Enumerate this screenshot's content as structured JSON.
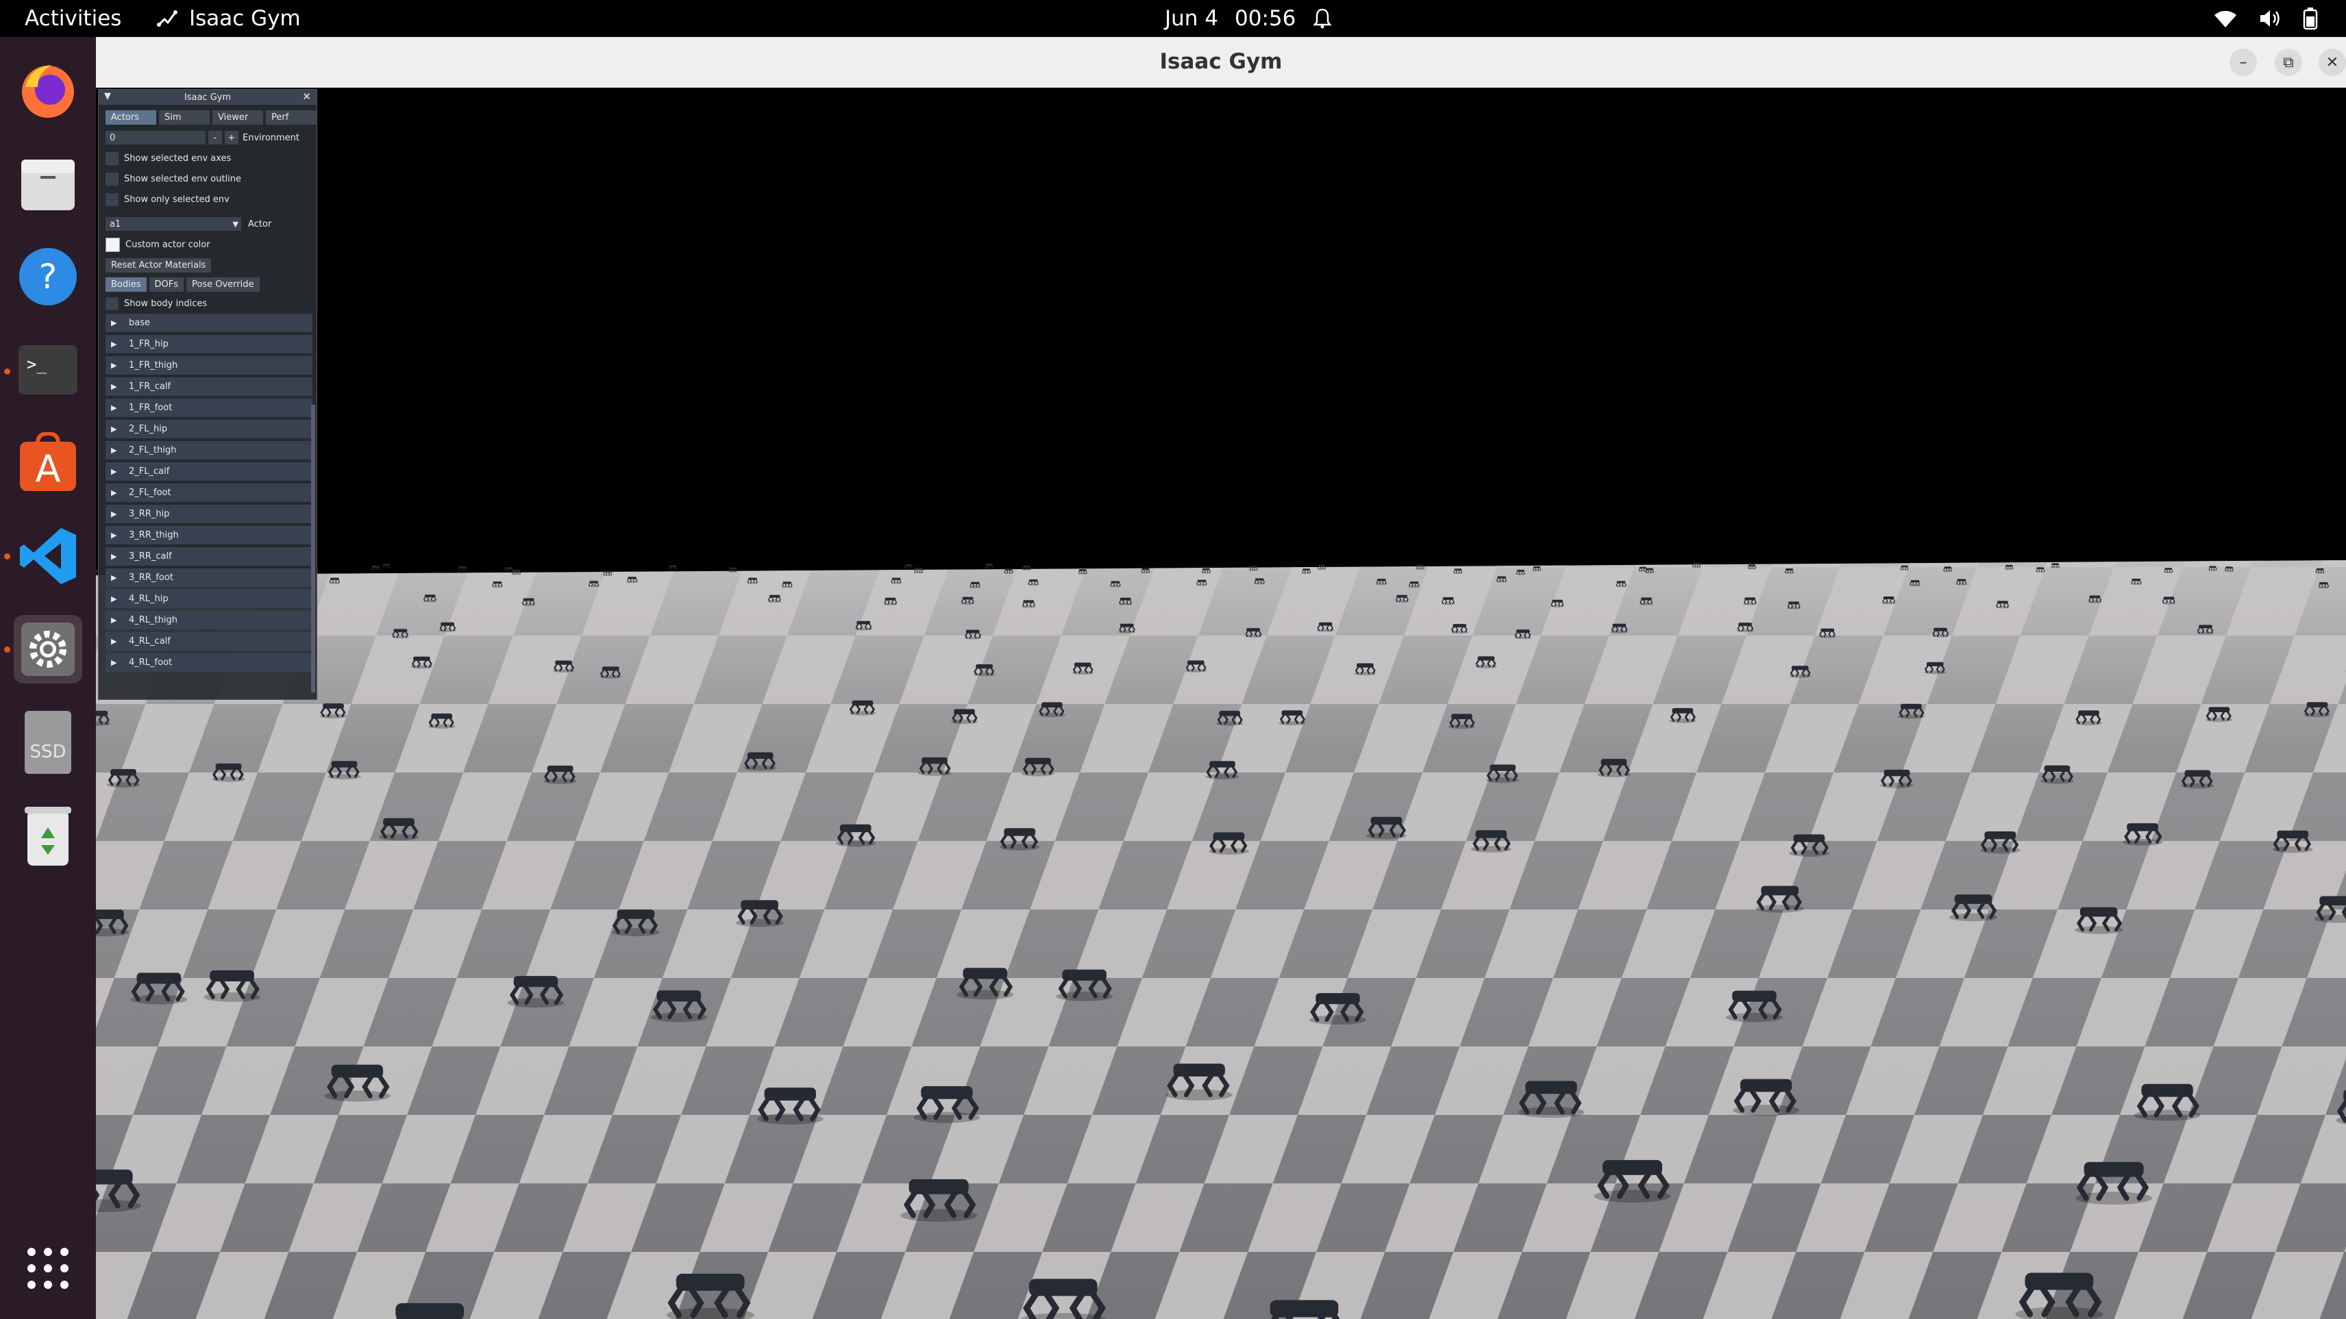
{
  "topbar": {
    "activities": "Activities",
    "app_name": "Isaac Gym",
    "date": "Jun 4",
    "time": "00:56"
  },
  "dock": {
    "icons": [
      "firefox-icon",
      "files-icon",
      "help-icon",
      "terminal-icon",
      "app-center-icon",
      "vscode-icon",
      "settings-icon",
      "ssd-drive-icon",
      "trash-icon",
      "show-apps-icon"
    ],
    "ssd_label": "SSD"
  },
  "window": {
    "title": "Isaac Gym"
  },
  "panel": {
    "title": "Isaac Gym",
    "tabs": [
      "Actors",
      "Sim",
      "Viewer",
      "Perf"
    ],
    "active_tab": "Actors",
    "env_value": "0",
    "env_minus": "-",
    "env_plus": "+",
    "env_label": "Environment",
    "options": [
      "Show selected env axes",
      "Show selected env outline",
      "Show only selected env"
    ],
    "actor_value": "a1",
    "actor_label": "Actor",
    "custom_color_label": "Custom actor color",
    "reset_button": "Reset Actor Materials",
    "subtabs": [
      "Bodies",
      "DOFs",
      "Pose Override"
    ],
    "active_subtab": "Bodies",
    "show_indices_label": "Show body indices",
    "bodies": [
      "base",
      "1_FR_hip",
      "1_FR_thigh",
      "1_FR_calf",
      "1_FR_foot",
      "2_FL_hip",
      "2_FL_thigh",
      "2_FL_calf",
      "2_FL_foot",
      "3_RR_hip",
      "3_RR_thigh",
      "3_RR_calf",
      "3_RR_foot",
      "4_RL_hip",
      "4_RL_thigh",
      "4_RL_calf",
      "4_RL_foot"
    ]
  },
  "scene": {
    "sky_color": "#000000",
    "floor_light": "#bfbcbd",
    "floor_dark": "#76767a",
    "robot_color": "#262a33"
  }
}
